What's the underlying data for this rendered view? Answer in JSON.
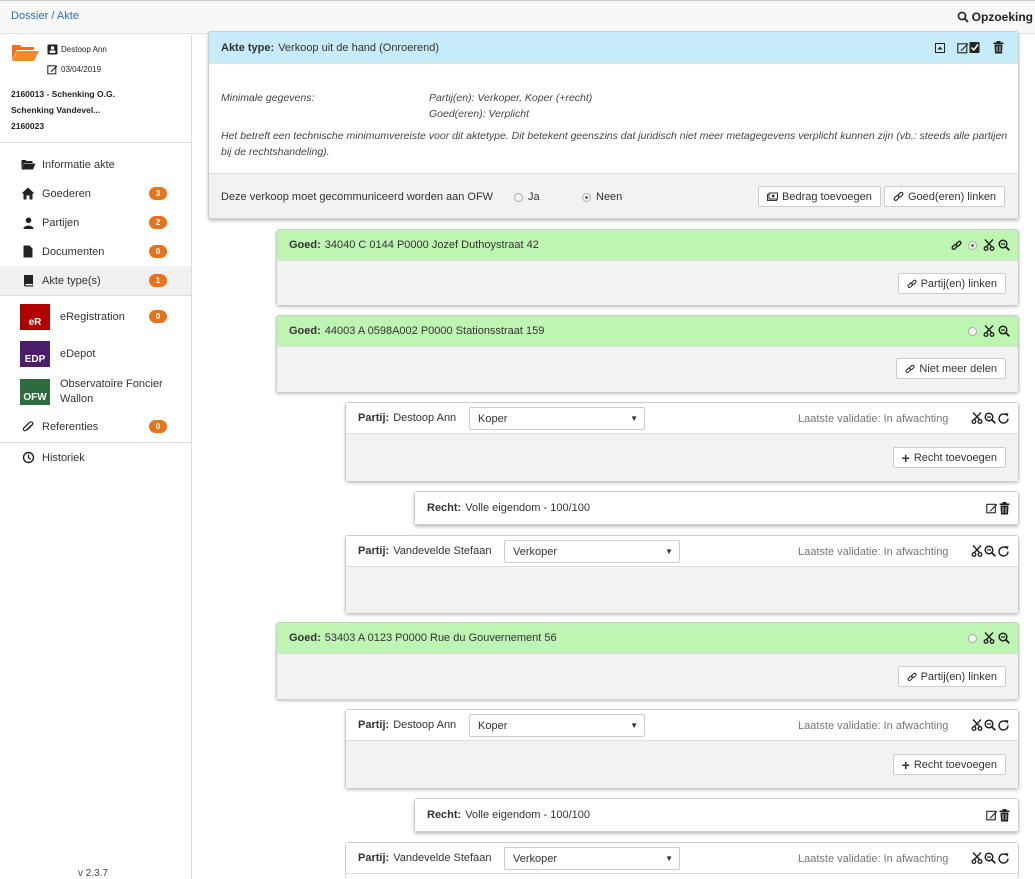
{
  "header": {
    "breadcrumb_dossier": "Dossier",
    "breadcrumb_sep": " / ",
    "breadcrumb_akte": "Akte",
    "search_label": "Opzoeking"
  },
  "sidebar": {
    "user_name": "Destoop Ann",
    "date": "03/04/2019",
    "dossiers": [
      "2160013 - Schenking O.G.",
      "Schenking Vandevel...",
      "2160023"
    ],
    "items": [
      {
        "label": "Informatie akte",
        "icon": "folder-open-icon",
        "badge": null
      },
      {
        "label": "Goederen",
        "icon": "home-icon",
        "badge": "3"
      },
      {
        "label": "Partijen",
        "icon": "user-icon",
        "badge": "2"
      },
      {
        "label": "Documenten",
        "icon": "file-icon",
        "badge": "0"
      },
      {
        "label": "Akte type(s)",
        "icon": "book-icon",
        "badge": "1"
      }
    ],
    "external": [
      {
        "label": "eRegistration",
        "logo": "eR",
        "color": "#b00000",
        "badge": "0"
      },
      {
        "label": "eDepot",
        "logo": "EDP",
        "color": "#4b1d6b",
        "badge": null
      },
      {
        "label_line1": "Observatoire Foncier",
        "label_line2": "Wallon",
        "logo": "OFW",
        "color": "#2e6b3e",
        "badge": null
      }
    ],
    "referenties": {
      "label": "Referenties",
      "badge": "0"
    },
    "historiek": {
      "label": "Historiek"
    },
    "version": "v 2.3.7"
  },
  "akte": {
    "title_label": "Akte type:",
    "title_value": "Verkoop uit de hand (Onroerend)",
    "minimal_label": "Minimale gegevens:",
    "minimal_partijen": "Partij(en): Verkoper, Koper (+recht)",
    "minimal_goederen": "Goed(eren): Verplicht",
    "note": "Het betreft een technische minimumvereiste voor dit aktetype. Dit betekent geenszins dat juridisch niet meer metagegevens verplicht kunnen zijn (vb.: steeds alle partijen bij de rechtshandeling).",
    "ofw_question": "Deze verkoop moet gecommuniceerd worden aan OFW",
    "ofw_yes": "Ja",
    "ofw_no": "Neen",
    "btn_bedrag": "Bedrag toevoegen",
    "btn_goed_linken": "Goed(eren) linken"
  },
  "labels": {
    "goed": "Goed:",
    "partij": "Partij:",
    "recht": "Recht:",
    "partijen_linken": "Partij(en) linken",
    "niet_meer_delen": "Niet meer delen",
    "recht_toevoegen": "Recht toevoegen",
    "validatie": "Laatste validatie: In afwachting"
  },
  "goederen": [
    {
      "value": "34040 C 0144 P0000 Jozef Duthoystraat 42"
    },
    {
      "value": "44003 A 0598A002 P0000 Stationsstraat 159"
    },
    {
      "value": "53403 A 0123 P0000 Rue du Gouvernement 56"
    }
  ],
  "partijen": [
    {
      "name": "Destoop Ann",
      "role": "Koper"
    },
    {
      "name": "Vandevelde Stefaan",
      "role": "Verkoper"
    },
    {
      "name": "Destoop Ann",
      "role": "Koper"
    },
    {
      "name": "Vandevelde Stefaan",
      "role": "Verkoper"
    }
  ],
  "rechten": [
    {
      "value": "Volle eigendom - 100/100"
    },
    {
      "value": "Volle eigendom - 100/100"
    }
  ]
}
